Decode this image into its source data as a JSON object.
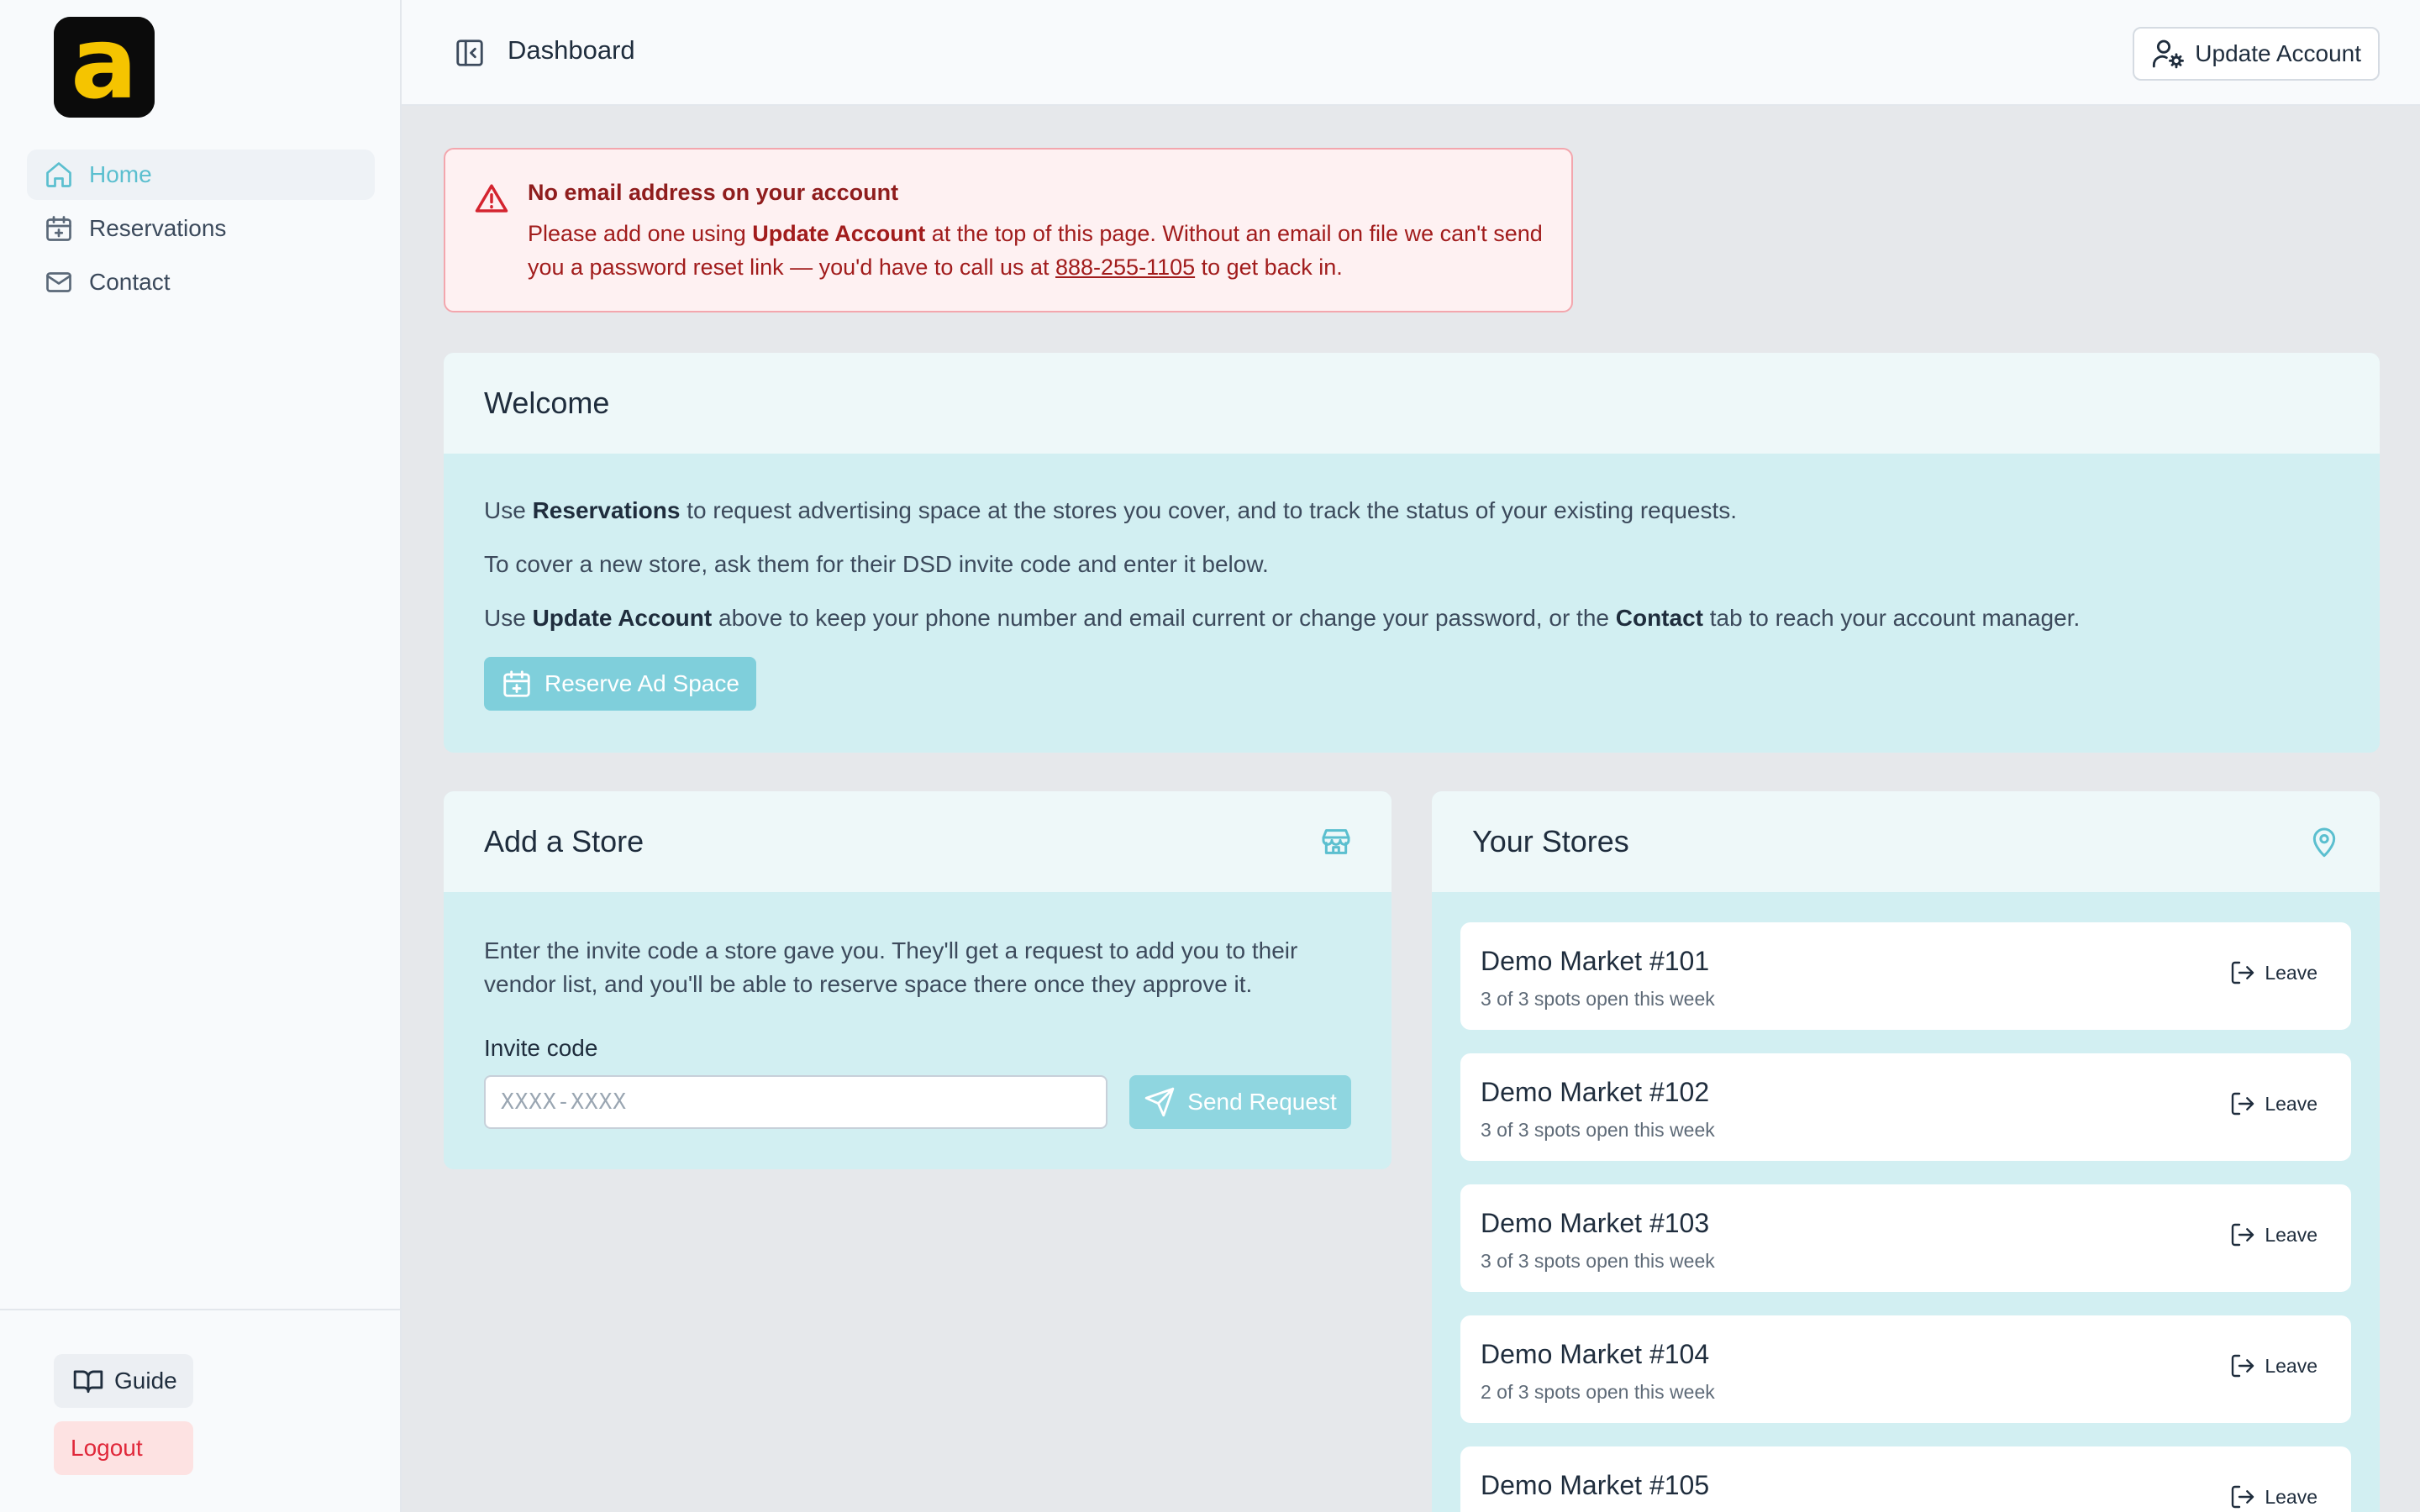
{
  "brand": {
    "logo_letter": "a",
    "logo_bg": "#0b0b0b",
    "logo_fg": "#f5c400"
  },
  "sidebar": {
    "items": [
      {
        "label": "Home",
        "icon": "home-icon",
        "active": true
      },
      {
        "label": "Reservations",
        "icon": "calendar-plus-icon",
        "active": false
      },
      {
        "label": "Contact",
        "icon": "mail-icon",
        "active": false
      }
    ],
    "guide_label": "Guide",
    "logout_label": "Logout"
  },
  "topbar": {
    "title": "Dashboard",
    "update_account_label": "Update Account"
  },
  "alert": {
    "title": "No email address on your account",
    "body_part1": "Please add one using ",
    "body_bold": "Update Account",
    "body_part2": " at the top of this page. Without an email on file we can't send you a password reset link — you'd have to call us at ",
    "phone": "888-255-1105",
    "body_part3": " to get back in."
  },
  "welcome": {
    "title": "Welcome",
    "line1_pre": "Use ",
    "line1_bold": "Reservations",
    "line1_post": " to request advertising space at the stores you cover, and to track the status of your existing requests.",
    "line2": "To cover a new store, ask them for their DSD invite code and enter it below.",
    "line3_pre": "Use ",
    "line3_bold1": "Update Account",
    "line3_mid": " above to keep your phone number and email current or change your password, or the ",
    "line3_bold2": "Contact",
    "line3_post": " tab to reach your account manager.",
    "reserve_label": "Reserve Ad Space"
  },
  "add_store": {
    "title": "Add a Store",
    "description": "Enter the invite code a store gave you. They'll get a request to add you to their vendor list, and you'll be able to reserve space there once they approve it.",
    "invite_label": "Invite code",
    "invite_placeholder": "XXXX-XXXX",
    "invite_value": "",
    "send_label": "Send Request"
  },
  "your_stores": {
    "title": "Your Stores",
    "leave_label": "Leave",
    "stores": [
      {
        "name": "Demo Market #101",
        "availability": "3 of 3 spots open this week"
      },
      {
        "name": "Demo Market #102",
        "availability": "3 of 3 spots open this week"
      },
      {
        "name": "Demo Market #103",
        "availability": "3 of 3 spots open this week"
      },
      {
        "name": "Demo Market #104",
        "availability": "2 of 3 spots open this week"
      },
      {
        "name": "Demo Market #105",
        "availability": ""
      }
    ]
  },
  "colors": {
    "accent": "#5bbfcf",
    "card_body": "#d2eff2",
    "card_head": "#eef8f9",
    "alert_bg": "#fef1f2",
    "alert_text": "#a11c1c",
    "logout": "#e0283a"
  }
}
